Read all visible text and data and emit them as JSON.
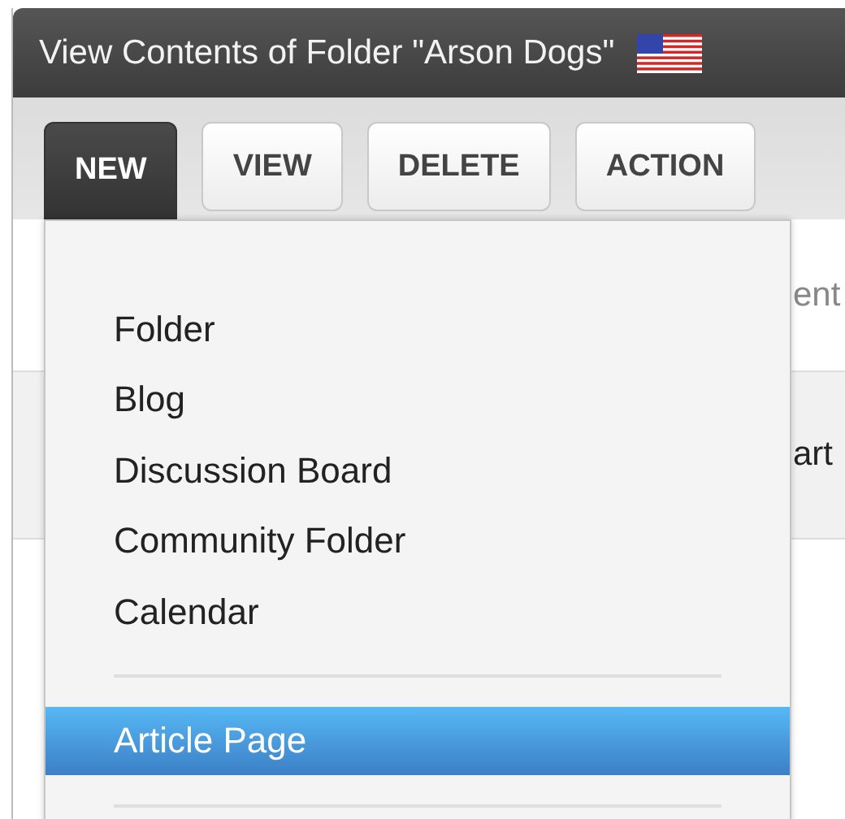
{
  "window": {
    "title": "View Contents of Folder \"Arson Dogs\""
  },
  "toolbar": [
    {
      "label": "NEW",
      "selected": true
    },
    {
      "label": "VIEW",
      "selected": false
    },
    {
      "label": "DELETE",
      "selected": false
    },
    {
      "label": "ACTION",
      "selected": false
    }
  ],
  "background_rows": [
    {
      "text": "ent",
      "shaded": false
    },
    {
      "text": "art",
      "shaded": true
    }
  ],
  "new_menu": [
    {
      "kind": "item",
      "label": "Folder",
      "selected": false
    },
    {
      "kind": "item",
      "label": "Blog",
      "selected": false
    },
    {
      "kind": "item",
      "label": "Discussion Board",
      "selected": false
    },
    {
      "kind": "item",
      "label": "Community Folder",
      "selected": false
    },
    {
      "kind": "item",
      "label": "Calendar",
      "selected": false
    },
    {
      "kind": "separator"
    },
    {
      "kind": "item",
      "label": "Article Page",
      "selected": true
    },
    {
      "kind": "separator"
    }
  ]
}
